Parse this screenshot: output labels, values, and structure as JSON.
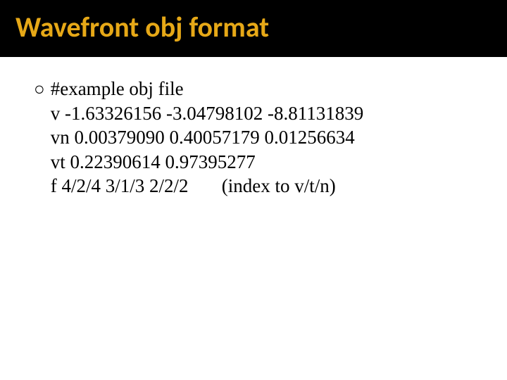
{
  "slide": {
    "title": "Wavefront obj format",
    "bullet_glyph": "○",
    "lines": {
      "l0": "#example obj file",
      "l1": "v -1.63326156 -3.04798102 -8.81131839",
      "l2": "vn 0.00379090 0.40057179 0.01256634",
      "l3": "vt 0.22390614 0.97395277",
      "l4": "f 4/2/4 3/1/3 2/2/2       (index to v/t/n)"
    }
  }
}
